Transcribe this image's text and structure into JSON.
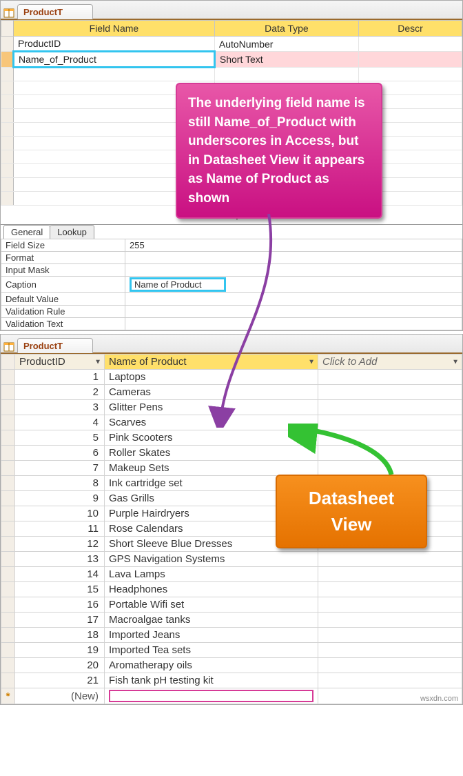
{
  "design_view": {
    "tab_title": "ProductT",
    "columns": {
      "field_name": "Field Name",
      "data_type": "Data Type",
      "description": "Descr"
    },
    "rows": [
      {
        "field": "ProductID",
        "type": "AutoNumber",
        "selected": false,
        "highlight": false
      },
      {
        "field": "Name_of_Product",
        "type": "Short Text",
        "selected": true,
        "highlight": true
      }
    ],
    "blank_rows": 10
  },
  "callout_pink": "The underlying field name is still Name_of_Product with underscores in Access, but in Datasheet View it appears as Name of Product as shown",
  "field_properties": {
    "label": "Field Properties",
    "tabs": {
      "general": "General",
      "lookup": "Lookup"
    },
    "rows": [
      {
        "label": "Field Size",
        "value": "255"
      },
      {
        "label": "Format",
        "value": ""
      },
      {
        "label": "Input Mask",
        "value": ""
      },
      {
        "label": "Caption",
        "value": "Name of Product",
        "highlight": true
      },
      {
        "label": "Default Value",
        "value": ""
      },
      {
        "label": "Validation Rule",
        "value": ""
      },
      {
        "label": "Validation Text",
        "value": ""
      }
    ]
  },
  "datasheet_view": {
    "tab_title": "ProductT",
    "columns": {
      "id": "ProductID",
      "name": "Name of Product",
      "add": "Click to Add"
    },
    "rows": [
      {
        "id": "1",
        "name": "Laptops"
      },
      {
        "id": "2",
        "name": "Cameras"
      },
      {
        "id": "3",
        "name": "Glitter Pens"
      },
      {
        "id": "4",
        "name": "Scarves"
      },
      {
        "id": "5",
        "name": "Pink Scooters"
      },
      {
        "id": "6",
        "name": "Roller Skates"
      },
      {
        "id": "7",
        "name": "Makeup Sets"
      },
      {
        "id": "8",
        "name": "Ink cartridge set"
      },
      {
        "id": "9",
        "name": "Gas Grills"
      },
      {
        "id": "10",
        "name": "Purple Hairdryers"
      },
      {
        "id": "11",
        "name": "Rose Calendars"
      },
      {
        "id": "12",
        "name": "Short Sleeve Blue Dresses"
      },
      {
        "id": "13",
        "name": "GPS Navigation Systems"
      },
      {
        "id": "14",
        "name": "Lava Lamps"
      },
      {
        "id": "15",
        "name": "Headphones"
      },
      {
        "id": "16",
        "name": "Portable Wifi set"
      },
      {
        "id": "17",
        "name": "Macroalgae tanks"
      },
      {
        "id": "18",
        "name": "Imported Jeans"
      },
      {
        "id": "19",
        "name": "Imported Tea sets"
      },
      {
        "id": "20",
        "name": "Aromatherapy oils"
      },
      {
        "id": "21",
        "name": "Fish tank pH testing kit"
      }
    ],
    "new_row_label": "(New)"
  },
  "callout_orange": "Datasheet View",
  "attribution": "wsxdn.com"
}
